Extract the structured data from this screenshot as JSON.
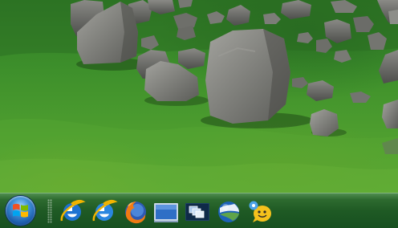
{
  "taskbar": {
    "start_button": {
      "icon": "windows-logo-icon"
    },
    "quick_launch": [
      {
        "id": "internet-explorer",
        "icon": "internet-explorer-icon"
      },
      {
        "id": "internet-explorer-2",
        "icon": "internet-explorer-icon"
      },
      {
        "id": "firefox",
        "icon": "firefox-icon"
      },
      {
        "id": "show-desktop",
        "icon": "show-desktop-icon"
      },
      {
        "id": "switch-windows",
        "icon": "switch-windows-icon"
      },
      {
        "id": "google-earth",
        "icon": "google-earth-icon"
      },
      {
        "id": "messenger",
        "icon": "messenger-icon"
      }
    ]
  },
  "colors": {
    "taskbar": "#1f5a24",
    "grass": "#4e9e2f",
    "stone": "#6e6e6e",
    "start_orb": "#1b5aa8"
  }
}
